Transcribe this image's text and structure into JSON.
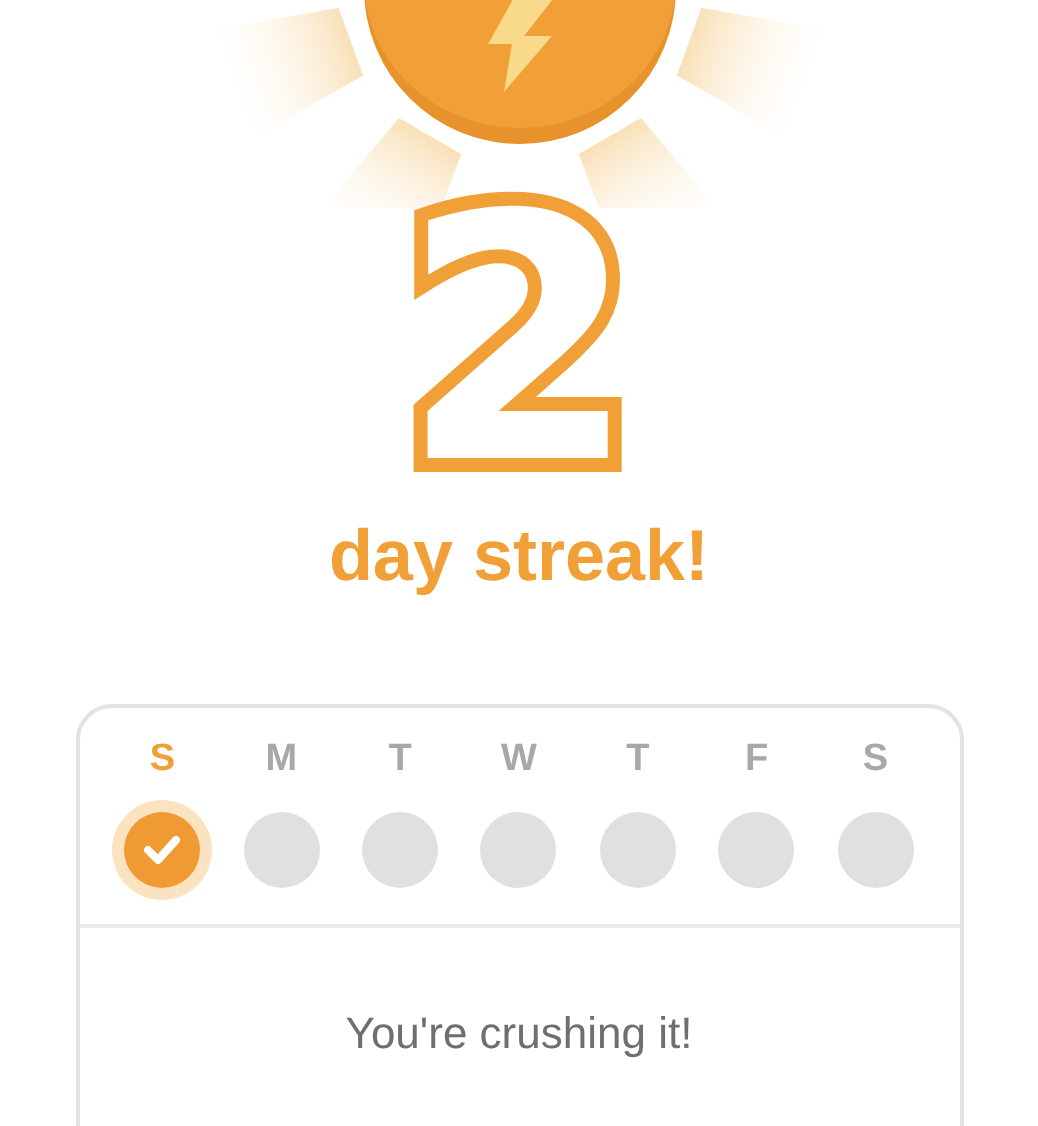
{
  "streak": {
    "count": "2",
    "label": "day streak!"
  },
  "week": [
    {
      "label": "S",
      "selected": true,
      "checked": true
    },
    {
      "label": "M",
      "selected": false,
      "checked": false
    },
    {
      "label": "T",
      "selected": false,
      "checked": false
    },
    {
      "label": "W",
      "selected": false,
      "checked": false
    },
    {
      "label": "T",
      "selected": false,
      "checked": false
    },
    {
      "label": "F",
      "selected": false,
      "checked": false
    },
    {
      "label": "S",
      "selected": false,
      "checked": false
    }
  ],
  "message": "You're crushing it!"
}
